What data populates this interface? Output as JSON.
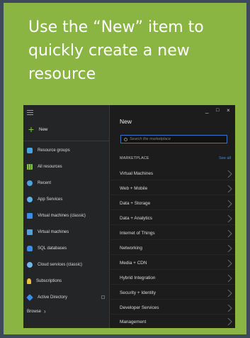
{
  "headline": "Use the “New” item to quickly create a new resource",
  "colors": {
    "background": "#3d4a5b",
    "card": "#8ab543",
    "portal_dark": "#1c1c1c",
    "accent_blue": "#3b8ee8",
    "plus_green": "#7ec542"
  },
  "sidebar": {
    "menu_icon": "hamburger-icon",
    "new_label": "New",
    "items": [
      {
        "label": "Resource groups",
        "icon": "resource-groups-icon"
      },
      {
        "label": "All resources",
        "icon": "all-resources-icon"
      },
      {
        "label": "Recent",
        "icon": "recent-icon"
      },
      {
        "label": "App Services",
        "icon": "app-services-icon"
      },
      {
        "label": "Virtual machines (classic)",
        "icon": "vm-classic-icon"
      },
      {
        "label": "Virtual machines",
        "icon": "vm-icon"
      },
      {
        "label": "SQL databases",
        "icon": "sql-database-icon"
      },
      {
        "label": "Cloud services (classic)",
        "icon": "cloud-services-icon"
      },
      {
        "label": "Subscriptions",
        "icon": "subscriptions-icon"
      },
      {
        "label": "Active Directory",
        "icon": "active-directory-icon"
      }
    ],
    "browse_label": "Browse",
    "browse_icon": "chevron-right-icon"
  },
  "new_blade": {
    "title": "New",
    "search_placeholder": "Search the marketplace",
    "section_label": "MARKETPLACE",
    "see_all": "See all",
    "window_controls": [
      "_",
      "□",
      "×"
    ],
    "categories": [
      "Virtual Machines",
      "Web + Mobile",
      "Data + Storage",
      "Data + Analytics",
      "Internet of Things",
      "Networking",
      "Media + CDN",
      "Hybrid Integration",
      "Security + Identity",
      "Developer Services",
      "Management"
    ]
  }
}
